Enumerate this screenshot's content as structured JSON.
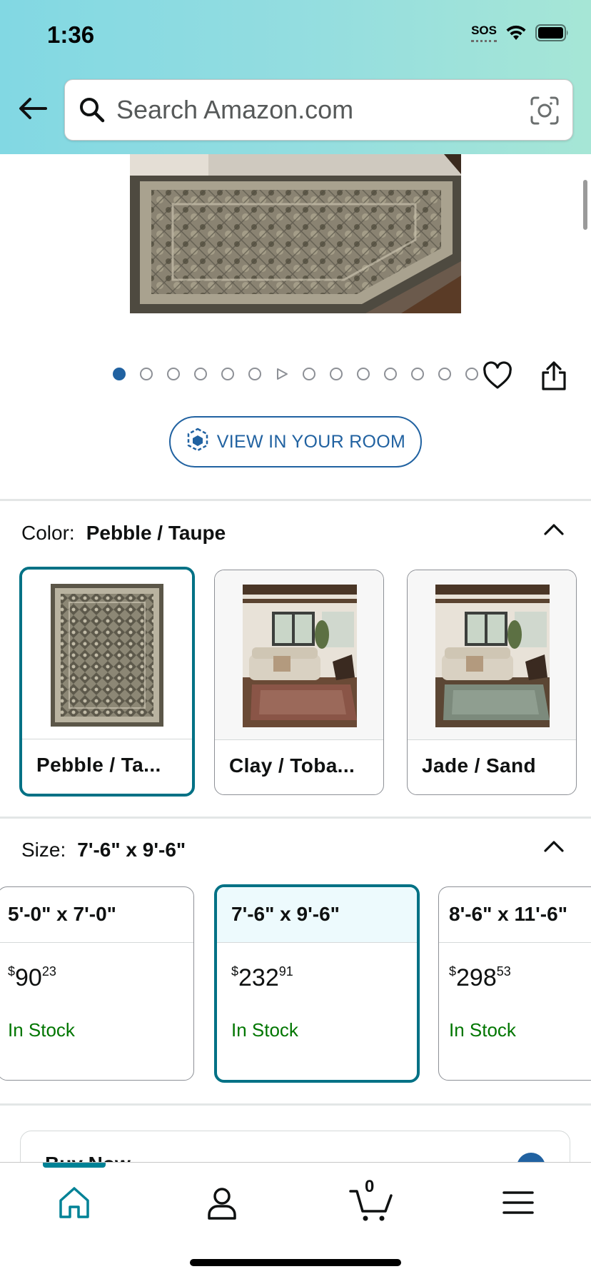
{
  "status_bar": {
    "time": "1:36",
    "sos": "SOS"
  },
  "search": {
    "placeholder": "Search Amazon.com"
  },
  "carousel": {
    "total_slides": 14,
    "current_index": 0
  },
  "view_in_room": {
    "label": "VIEW IN YOUR ROOM"
  },
  "color": {
    "label": "Color:",
    "selected": "Pebble / Taupe",
    "options": [
      {
        "name": "Pebble / Ta..."
      },
      {
        "name": "Clay / Toba..."
      },
      {
        "name": "Jade / Sand"
      }
    ]
  },
  "size": {
    "label": "Size:",
    "selected": "7'-6\" x 9'-6\"",
    "options": [
      {
        "name": "5'-0\" x 7'-0\"",
        "price_whole": "90",
        "price_fraction": "23",
        "currency": "$",
        "stock": "In Stock"
      },
      {
        "name": "7'-6\" x 9'-6\"",
        "price_whole": "232",
        "price_fraction": "91",
        "currency": "$",
        "stock": "In Stock"
      },
      {
        "name": "8'-6\" x 11'-6\"",
        "price_whole": "298",
        "price_fraction": "53",
        "currency": "$",
        "stock": "In Stock"
      }
    ]
  },
  "buy_box": {
    "label": "Buy Now"
  },
  "nav": {
    "cart_count": "0"
  },
  "colors": {
    "accent": "#007185",
    "link": "#2162a1",
    "in_stock": "#007600",
    "nav_active": "#008296"
  }
}
